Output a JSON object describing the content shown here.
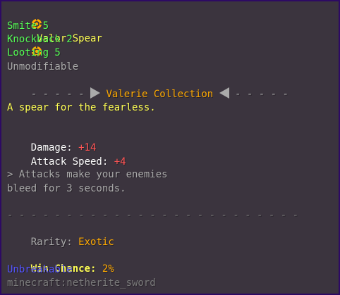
{
  "item": {
    "name": "Valor Spear",
    "enchantments": [
      "Smite 5",
      "Knockback 2",
      "Looting 5"
    ],
    "unmodifiable": "Unmodifiable",
    "collection_dashes_left": "- - - - -",
    "collection_name": "Valerie Collection",
    "collection_dashes_right": "- - - - -",
    "flavor": "A spear for the fearless.",
    "stats": {
      "damage_label": "Damage:",
      "damage_value": "+14",
      "speed_label": "Attack Speed:",
      "speed_value": "+4"
    },
    "ability_line1": "> Attacks make your enemies",
    "ability_line2": "bleed for 3 seconds.",
    "divider": "- - - - - - - - - - - - - - - - - - - - - - - - -",
    "rarity_label": "Rarity:",
    "rarity_value": "Exotic",
    "win_chance_label": "Win Chance:",
    "win_chance_value": "2%",
    "unbreakable": "Unbreakable",
    "item_id": "minecraft:netherite_sword"
  },
  "colors": {
    "background": "#3b343e",
    "border": "#2d0a63",
    "title": "#ffff55",
    "enchant": "#55ff55",
    "gold": "#ffaa00",
    "red": "#ff5555",
    "blue": "#5555ff",
    "gray": "#aaaaaa"
  },
  "icons": {
    "title_icon": "sun-icon",
    "collection_arrows": [
      "triangle-right-icon",
      "triangle-left-icon"
    ]
  }
}
